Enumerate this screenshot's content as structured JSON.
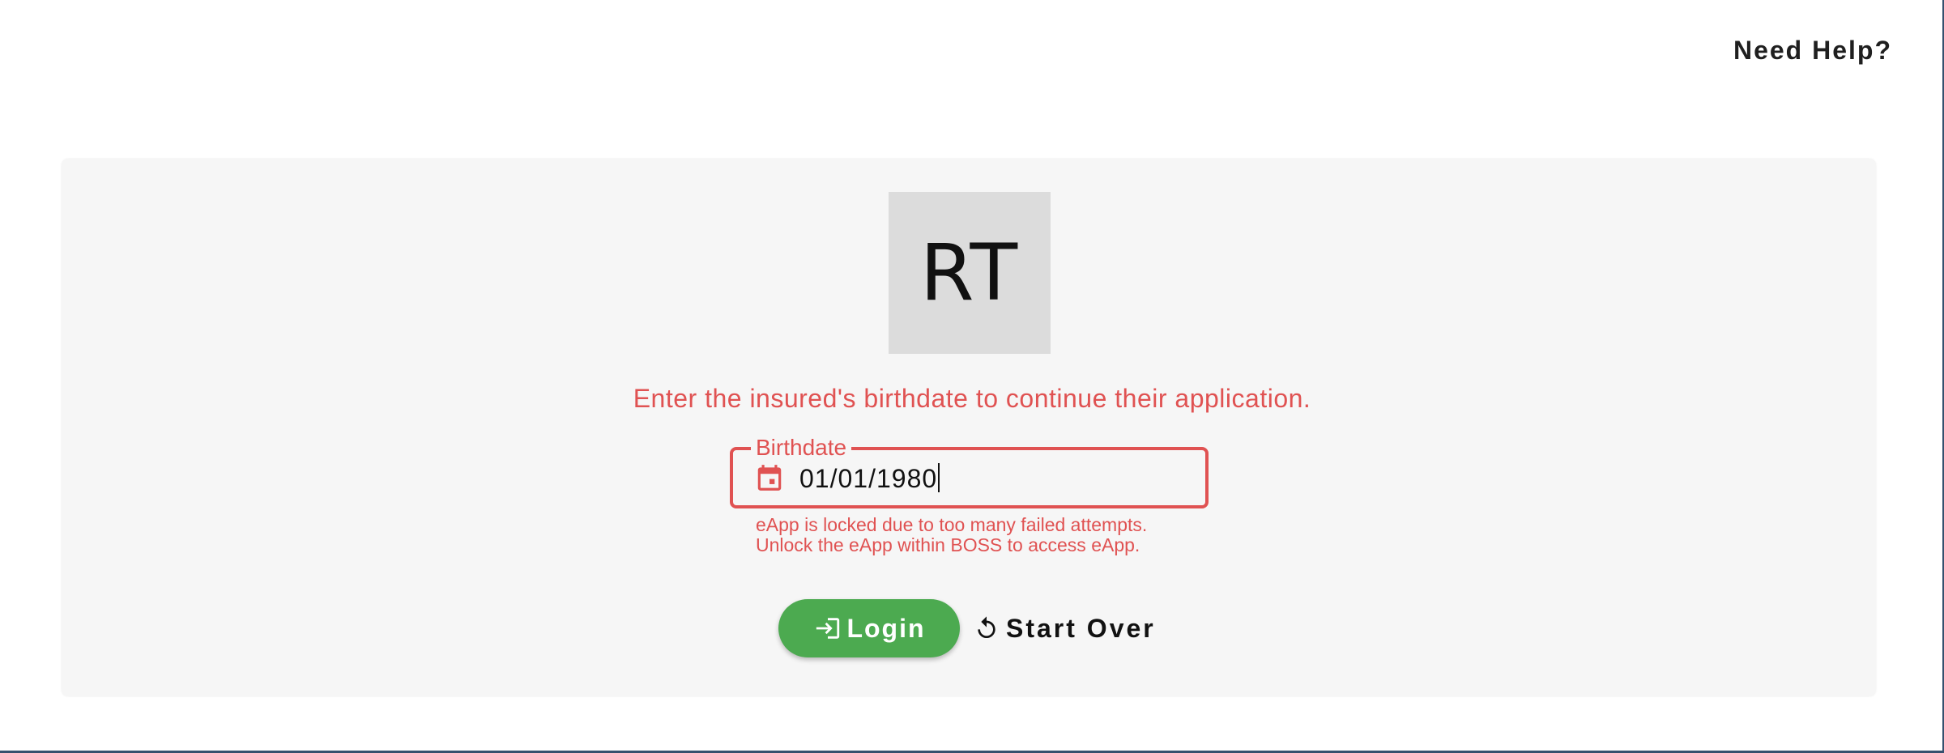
{
  "header": {
    "help_link": "Need Help?"
  },
  "logo": {
    "initials": "RT"
  },
  "main": {
    "prompt": "Enter the insured's birthdate to continue their application.",
    "birthdate_field": {
      "label": "Birthdate",
      "value": "01/01/1980",
      "icon": "calendar-icon"
    },
    "error_lines": [
      "eApp is locked due to too many failed attempts.",
      "Unlock the eApp within BOSS to access eApp."
    ],
    "login_button": {
      "label": "Login",
      "icon": "login-icon"
    },
    "start_over_button": {
      "label": "Start Over",
      "icon": "refresh-icon"
    }
  },
  "colors": {
    "error": "#e05252",
    "login_bg": "#4caa50",
    "card_bg": "#f6f6f6",
    "logo_bg": "#dcdcdc"
  }
}
